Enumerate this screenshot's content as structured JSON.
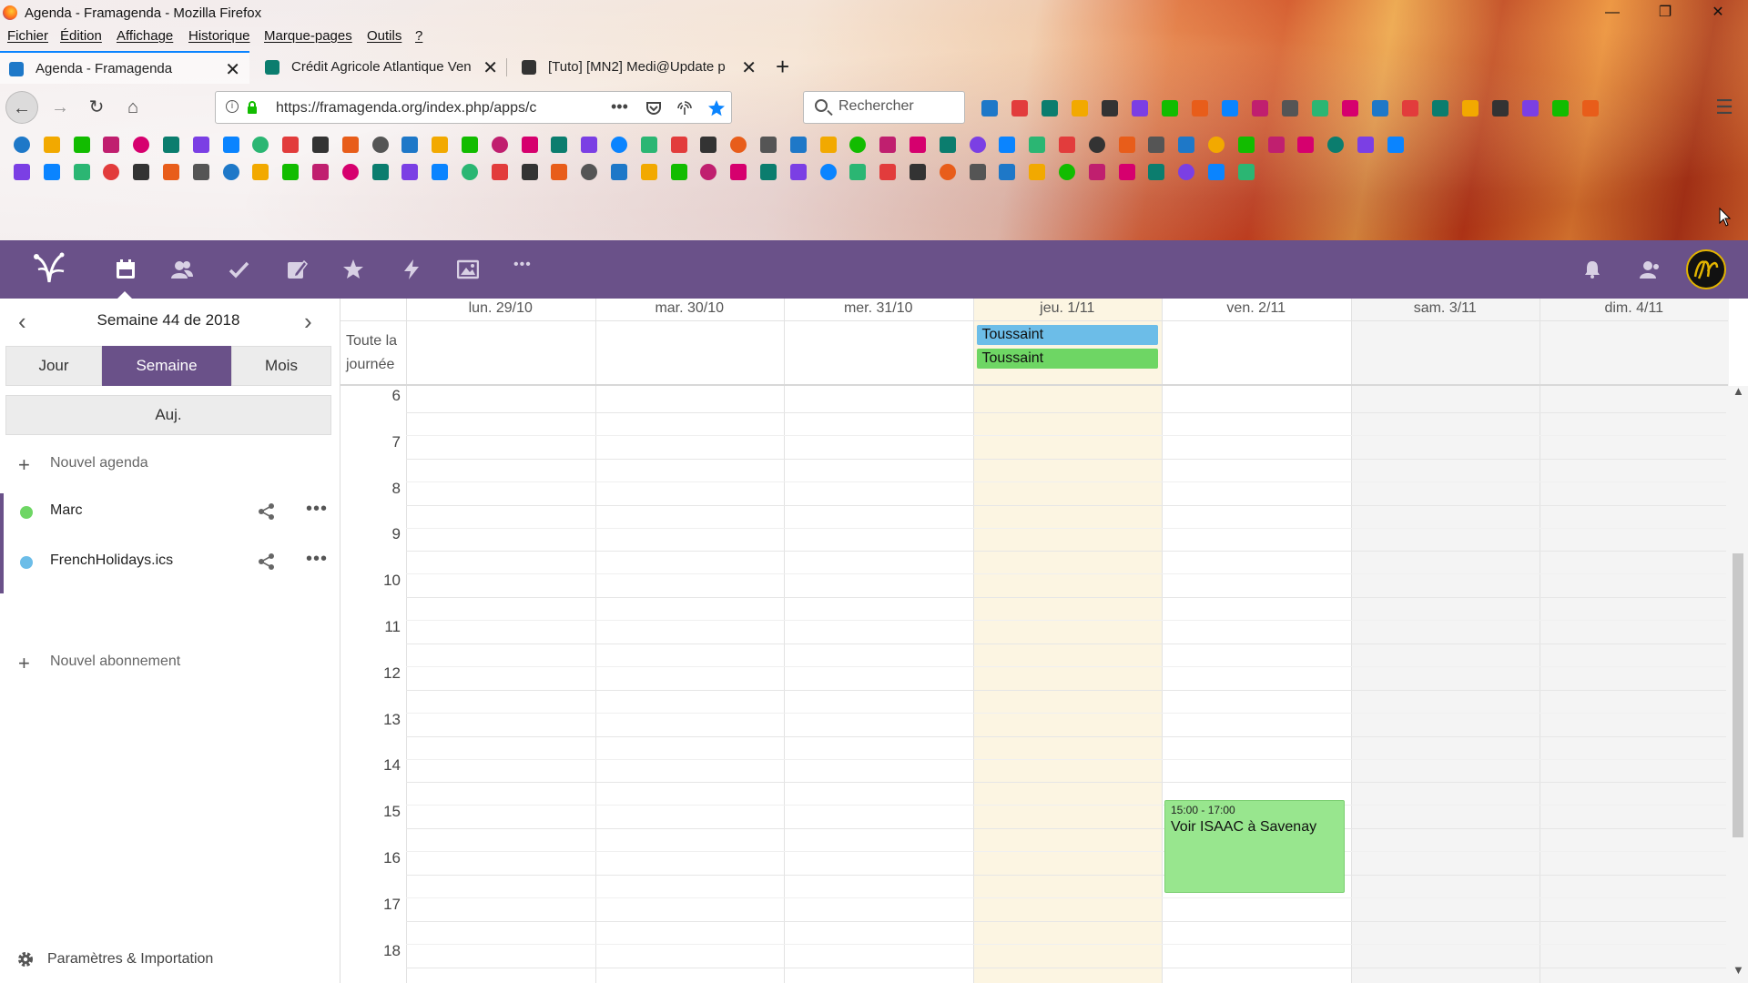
{
  "window": {
    "title": "Agenda - Framagenda - Mozilla Firefox",
    "controls": {
      "minimize": "—",
      "restore": "❐",
      "close": "✕"
    }
  },
  "menubar": [
    "Fichier",
    "Édition",
    "Affichage",
    "Historique",
    "Marque-pages",
    "Outils",
    "?"
  ],
  "tabs": [
    {
      "label": "Agenda - Framagenda",
      "active": true,
      "icon": "calendar-favicon",
      "color": "#1e78c8"
    },
    {
      "label": "Crédit Agricole Atlantique Ven",
      "active": false,
      "icon": "credit-agricole-favicon",
      "color": "#0b7d6e"
    },
    {
      "label": "[Tuto] [MN2] Medi@Update p",
      "active": false,
      "icon": "forum-favicon",
      "color": "#333333"
    }
  ],
  "navbar": {
    "url": "https://framagenda.org/index.php/apps/c",
    "search_placeholder": "Rechercher",
    "page_actions": "•••"
  },
  "icons": {
    "back": "←",
    "forward": "→",
    "reload": "↻",
    "home": "⌂",
    "close": "✕",
    "new_tab": "+",
    "menu": "☰"
  },
  "app": {
    "brand_color": "#6a5189",
    "nav_icons": [
      "calendar-icon",
      "contacts-icon",
      "tasks-icon",
      "notes-icon",
      "bookmarks-icon",
      "activity-icon",
      "gallery-icon",
      "more-apps-icon"
    ],
    "more_glyph": "•••"
  },
  "sidebar": {
    "week_label": "Semaine 44 de 2018",
    "prev": "‹",
    "next": "›",
    "views": [
      {
        "label": "Jour",
        "active": false
      },
      {
        "label": "Semaine",
        "active": true
      },
      {
        "label": "Mois",
        "active": false
      }
    ],
    "today": "Auj.",
    "new_calendar": "Nouvel agenda",
    "calendars": [
      {
        "name": "Marc",
        "color": "#6ed664"
      },
      {
        "name": "FrenchHolidays.ics",
        "color": "#6cbde8"
      }
    ],
    "more_glyph": "•••",
    "new_subscription": "Nouvel abonnement",
    "settings": "Paramètres & Importation"
  },
  "calendar": {
    "days": [
      {
        "label": "lun. 29/10",
        "weekend": false,
        "today": false
      },
      {
        "label": "mar. 30/10",
        "weekend": false,
        "today": false
      },
      {
        "label": "mer. 31/10",
        "weekend": false,
        "today": false
      },
      {
        "label": "jeu. 1/11",
        "weekend": false,
        "today": true
      },
      {
        "label": "ven. 2/11",
        "weekend": false,
        "today": false
      },
      {
        "label": "sam. 3/11",
        "weekend": true,
        "today": false
      },
      {
        "label": "dim. 4/11",
        "weekend": true,
        "today": false
      }
    ],
    "allday_label": "Toute la journée",
    "allday_events": [
      {
        "title": "Toussaint",
        "day": 3,
        "color": "#6cbde8"
      },
      {
        "title": "Toussaint",
        "day": 3,
        "color": "#6ed664"
      }
    ],
    "hours": [
      "6",
      "7",
      "8",
      "9",
      "10",
      "11",
      "12",
      "13",
      "14",
      "15",
      "16",
      "17",
      "18"
    ],
    "timed_event": {
      "time": "15:00 - 17:00",
      "title": "Voir ISAAC à Savenay",
      "day": 4,
      "color": "#98e68e"
    },
    "today_color": "#fcf5e2",
    "weekend_color": "#f4f4f4"
  }
}
